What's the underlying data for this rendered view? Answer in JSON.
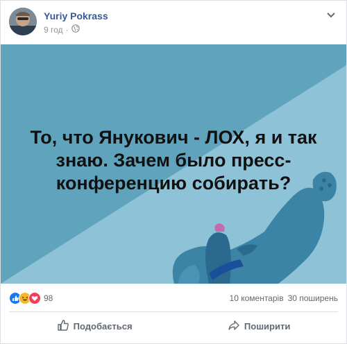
{
  "post": {
    "author": "Yuriy Pokrass",
    "time": "9 год",
    "time_separator": "·",
    "image_text": "То, что Янукович - ЛОХ, я и так знаю. Зачем было пресс-конференцию собирать?",
    "reactions": {
      "count": "98",
      "types": [
        "like",
        "haha",
        "love"
      ]
    },
    "comments": "10 коментарів",
    "shares": "30 поширень"
  },
  "actions": {
    "like_label": "Подобається",
    "share_label": "Поширити"
  },
  "colors": {
    "link": "#385898",
    "image_bg_dark": "#5fa3bd",
    "image_bg_light": "#8ec2d6",
    "creature": "#3c84a6",
    "creature_dark": "#2b6a8e",
    "collar": "#1a4f9a",
    "like_blue": "#1877f2",
    "haha_yellow": "#f7b928",
    "love_red": "#f33e58"
  }
}
